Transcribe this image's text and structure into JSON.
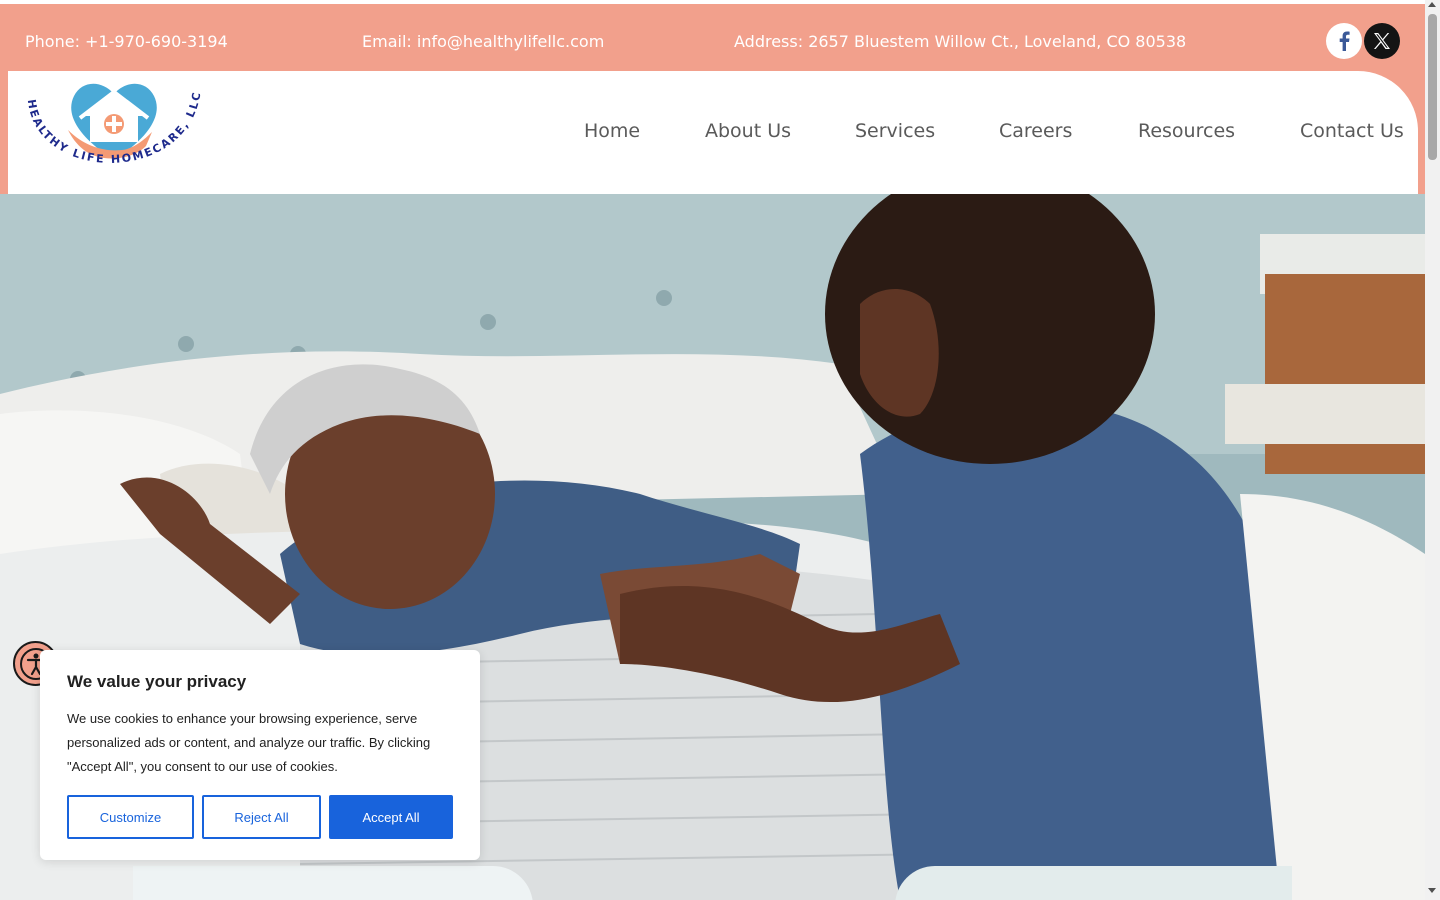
{
  "contact": {
    "phone": "Phone: +1-970-690-3194",
    "email": "Email: info@healthylifellc.com",
    "address": "Address: 2657 Bluestem Willow Ct., Loveland, CO 80538"
  },
  "social": {
    "facebook_icon": "facebook-icon",
    "x_icon": "x-icon"
  },
  "logo": {
    "text": "HEALTHY LIFE HOMECARE, LLC"
  },
  "nav": {
    "items": [
      {
        "label": "Home",
        "active": true
      },
      {
        "label": "About Us"
      },
      {
        "label": "Services"
      },
      {
        "label": "Careers"
      },
      {
        "label": "Resources"
      },
      {
        "label": "Contact Us"
      }
    ]
  },
  "cookie": {
    "title": "We value your privacy",
    "text": "We use cookies to enhance your browsing experience, serve personalized ads or content, and analyze our traffic. By clicking \"Accept All\", you consent to our use of cookies.",
    "customize": "Customize",
    "reject": "Reject All",
    "accept": "Accept All"
  },
  "colors": {
    "accent": "#f2a08c",
    "active_link": "#3bb0c9",
    "button_blue": "#1863dc",
    "logo_navy": "#1e2a8c"
  }
}
